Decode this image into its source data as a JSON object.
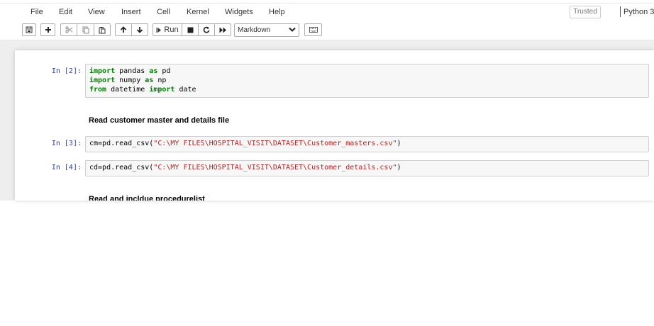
{
  "menubar": {
    "items": [
      "File",
      "Edit",
      "View",
      "Insert",
      "Cell",
      "Kernel",
      "Widgets",
      "Help"
    ],
    "trusted": "Trusted",
    "kernel": "Python 3"
  },
  "toolbar": {
    "run_label": "Run",
    "cell_type": "Markdown",
    "icons": [
      "save-icon",
      "plus-icon",
      "cut-icon",
      "copy-icon",
      "paste-icon",
      "arrow-up-icon",
      "arrow-down-icon",
      "run-icon",
      "stop-icon",
      "restart-icon",
      "fast-forward-icon",
      "keyboard-icon"
    ]
  },
  "cells": [
    {
      "type": "code",
      "prompt": "In [2]:",
      "lines": [
        [
          {
            "t": "import",
            "k": "kw"
          },
          {
            "t": " pandas ",
            "k": ""
          },
          {
            "t": "as",
            "k": "kw"
          },
          {
            "t": " pd",
            "k": ""
          }
        ],
        [
          {
            "t": "import",
            "k": "kw"
          },
          {
            "t": " numpy ",
            "k": ""
          },
          {
            "t": "as",
            "k": "kw"
          },
          {
            "t": " np",
            "k": ""
          }
        ],
        [
          {
            "t": "from",
            "k": "kw"
          },
          {
            "t": " datetime ",
            "k": ""
          },
          {
            "t": "import",
            "k": "kw"
          },
          {
            "t": " date",
            "k": ""
          }
        ]
      ]
    },
    {
      "type": "markdown",
      "text": "Read customer master and details file"
    },
    {
      "type": "code",
      "prompt": "In [3]:",
      "lines": [
        [
          {
            "t": "cm=pd.read_csv(",
            "k": ""
          },
          {
            "t": "\"C:\\MY FILES\\HOSPITAL_VISIT\\DATASET\\Customer_masters.csv\"",
            "k": "str"
          },
          {
            "t": ")",
            "k": ""
          }
        ]
      ]
    },
    {
      "type": "code",
      "prompt": "In [4]:",
      "lines": [
        [
          {
            "t": "cd=pd.read_csv(",
            "k": ""
          },
          {
            "t": "\"C:\\MY FILES\\HOSPITAL_VISIT\\DATASET\\Customer_details.csv\"",
            "k": "str"
          },
          {
            "t": ")",
            "k": ""
          }
        ]
      ]
    },
    {
      "type": "markdown",
      "text": "Read and incldue procedurelist"
    }
  ]
}
